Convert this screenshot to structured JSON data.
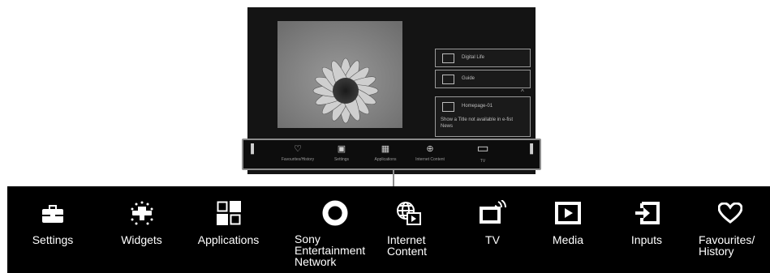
{
  "tv_screen": {
    "panels": [
      {
        "label": "Digital Life"
      },
      {
        "label": "Guide"
      },
      {
        "label": "Homepage-01",
        "description": "Show a Title not available in e-fist News"
      }
    ],
    "caret": "^"
  },
  "mini_menu": {
    "items": [
      {
        "label": "Favourites/History"
      },
      {
        "label": "Settings"
      },
      {
        "label": "Applications"
      },
      {
        "label": "Internet Content"
      },
      {
        "label": "TV"
      }
    ]
  },
  "menu": {
    "items": [
      {
        "label": "Settings",
        "icon": "briefcase-icon"
      },
      {
        "label": "Widgets",
        "icon": "widgets-icon"
      },
      {
        "label": "Applications",
        "icon": "applications-icon"
      },
      {
        "label": "Sony\nEntertainment\nNetwork",
        "icon": "ring-icon"
      },
      {
        "label": "Internet\nContent",
        "icon": "globe-icon"
      },
      {
        "label": "TV",
        "icon": "tv-icon"
      },
      {
        "label": "Media",
        "icon": "media-icon"
      },
      {
        "label": "Inputs",
        "icon": "input-icon"
      },
      {
        "label": "Favourites/\nHistory",
        "icon": "heart-icon"
      }
    ]
  }
}
